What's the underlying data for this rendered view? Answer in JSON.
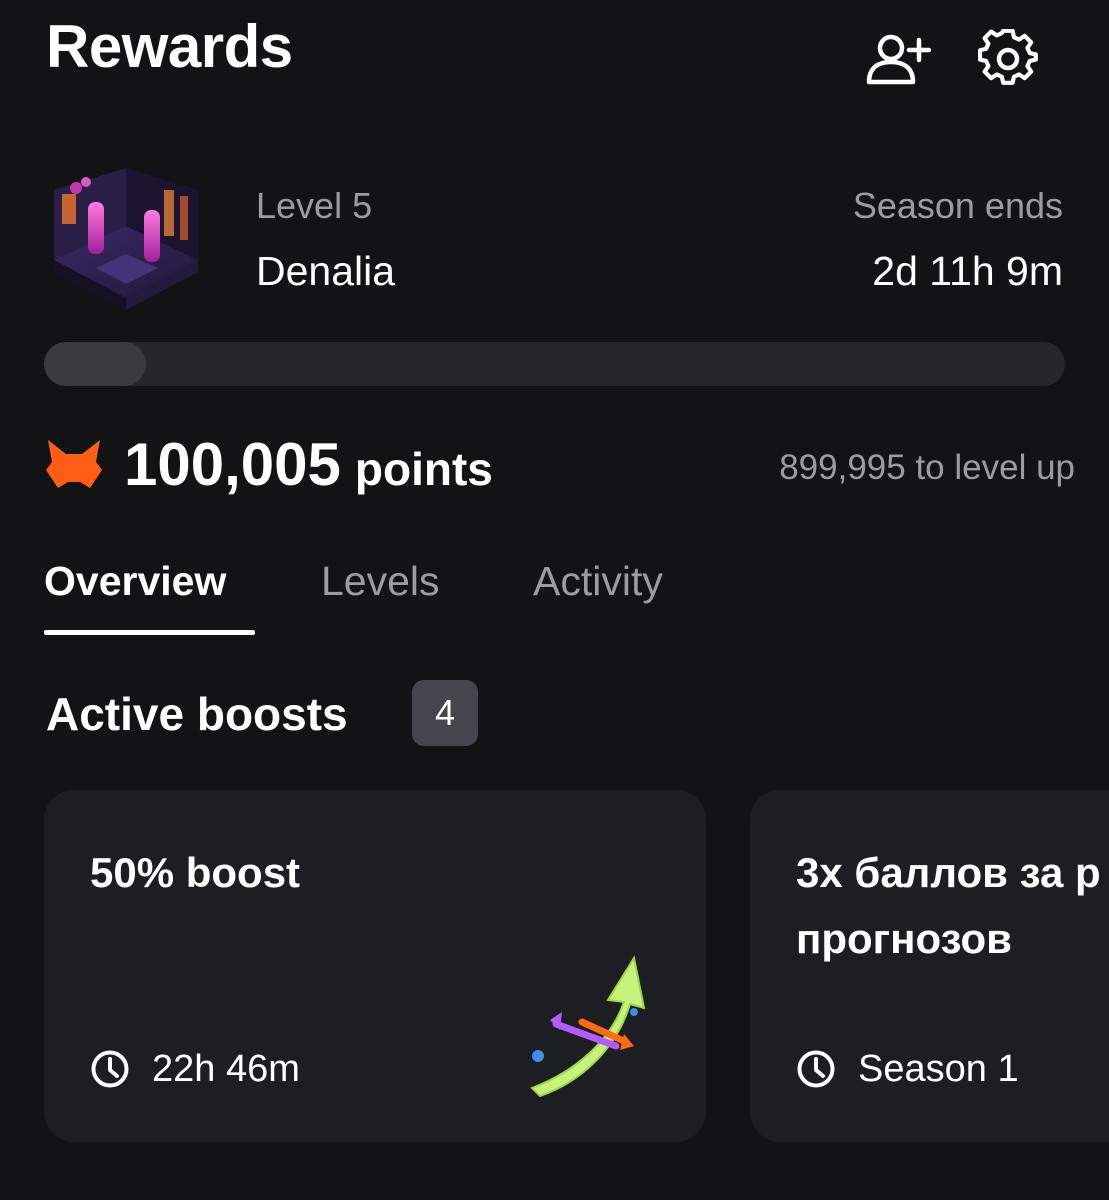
{
  "header": {
    "title": "Rewards",
    "add_friend_icon": "add-user-icon",
    "settings_icon": "gear-icon"
  },
  "level": {
    "label": "Level 5",
    "name": "Denalia",
    "season_label": "Season ends",
    "season_remaining": "2d 11h 9m",
    "progress_fraction": 0.1
  },
  "points": {
    "value": "100,005",
    "unit": "points",
    "to_level_up": "899,995 to level up",
    "icon": "fox-icon"
  },
  "tabs": [
    {
      "label": "Overview",
      "active": true
    },
    {
      "label": "Levels",
      "active": false
    },
    {
      "label": "Activity",
      "active": false
    }
  ],
  "boosts": {
    "title": "Active boosts",
    "count": "4",
    "cards": [
      {
        "title": "50% boost",
        "meta": "22h 46m",
        "meta_icon": "clock-icon"
      },
      {
        "title": "3x баллов за р",
        "title_line2": "прогнозов",
        "meta": "Season 1",
        "meta_icon": "clock-icon"
      }
    ]
  },
  "colors": {
    "background": "#121314",
    "card": "#1d1e21",
    "muted_text": "#9a9ca4",
    "badge": "#44464d",
    "accent_orange": "#ff5c16"
  }
}
